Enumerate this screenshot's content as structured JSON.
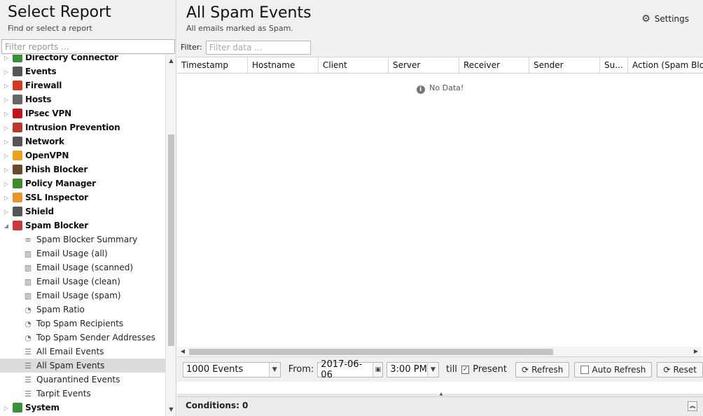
{
  "left": {
    "title": "Select Report",
    "subtitle": "Find or select a report",
    "filter_placeholder": "Filter reports ..."
  },
  "tree": [
    {
      "type": "category",
      "label": "Directory Connector",
      "icon": "directory-connector-icon",
      "color": "#3a8f3a",
      "expanded": false
    },
    {
      "type": "category",
      "label": "Events",
      "icon": "events-icon",
      "color": "#555555",
      "expanded": false
    },
    {
      "type": "category",
      "label": "Firewall",
      "icon": "firewall-icon",
      "color": "#d23a1e",
      "expanded": false
    },
    {
      "type": "category",
      "label": "Hosts",
      "icon": "hosts-icon",
      "color": "#666666",
      "expanded": false
    },
    {
      "type": "category",
      "label": "IPsec VPN",
      "icon": "ipsec-lock-icon",
      "color": "#c0141e",
      "expanded": false
    },
    {
      "type": "category",
      "label": "Intrusion Prevention",
      "icon": "intrusion-prevention-icon",
      "color": "#b83a2a",
      "expanded": false
    },
    {
      "type": "category",
      "label": "Network",
      "icon": "network-icon",
      "color": "#555555",
      "expanded": false
    },
    {
      "type": "category",
      "label": "OpenVPN",
      "icon": "openvpn-icon",
      "color": "#e8a21e",
      "expanded": false
    },
    {
      "type": "category",
      "label": "Phish Blocker",
      "icon": "phish-blocker-icon",
      "color": "#6a4a2a",
      "expanded": false
    },
    {
      "type": "category",
      "label": "Policy Manager",
      "icon": "policy-manager-icon",
      "color": "#3c8a2a",
      "expanded": false
    },
    {
      "type": "category",
      "label": "SSL Inspector",
      "icon": "ssl-inspector-icon",
      "color": "#e8942a",
      "expanded": false
    },
    {
      "type": "category",
      "label": "Shield",
      "icon": "shield-icon",
      "color": "#555555",
      "expanded": false
    },
    {
      "type": "category",
      "label": "Spam Blocker",
      "icon": "spam-blocker-icon",
      "color": "#c83a3a",
      "expanded": true
    },
    {
      "type": "leaf",
      "label": "Spam Blocker Summary",
      "icon": "text-lines-icon",
      "glyph": "≡"
    },
    {
      "type": "leaf",
      "label": "Email Usage (all)",
      "icon": "bar-chart-icon",
      "glyph": "📊"
    },
    {
      "type": "leaf",
      "label": "Email Usage (scanned)",
      "icon": "bar-chart-icon",
      "glyph": "📊"
    },
    {
      "type": "leaf",
      "label": "Email Usage (clean)",
      "icon": "bar-chart-icon",
      "glyph": "📊"
    },
    {
      "type": "leaf",
      "label": "Email Usage (spam)",
      "icon": "bar-chart-icon",
      "glyph": "📊"
    },
    {
      "type": "leaf",
      "label": "Spam Ratio",
      "icon": "pie-chart-icon",
      "glyph": "◔"
    },
    {
      "type": "leaf",
      "label": "Top Spam Recipients",
      "icon": "pie-chart-icon",
      "glyph": "◔"
    },
    {
      "type": "leaf",
      "label": "Top Spam Sender Addresses",
      "icon": "pie-chart-icon",
      "glyph": "◔"
    },
    {
      "type": "leaf",
      "label": "All Email Events",
      "icon": "list-icon",
      "glyph": "☰"
    },
    {
      "type": "leaf",
      "label": "All Spam Events",
      "icon": "list-icon",
      "glyph": "☰",
      "selected": true
    },
    {
      "type": "leaf",
      "label": "Quarantined Events",
      "icon": "list-icon",
      "glyph": "☰"
    },
    {
      "type": "leaf",
      "label": "Tarpit Events",
      "icon": "list-icon",
      "glyph": "☰"
    },
    {
      "type": "category",
      "label": "System",
      "icon": "system-icon",
      "color": "#3a8f3a",
      "expanded": false
    }
  ],
  "main": {
    "title": "All Spam Events",
    "subtitle": "All emails marked as Spam.",
    "settings_label": "Settings",
    "filter_label": "Filter:",
    "filter_placeholder": "Filter data ...",
    "columns": [
      {
        "label": "Timestamp"
      },
      {
        "label": "Hostname"
      },
      {
        "label": "Client"
      },
      {
        "label": "Server"
      },
      {
        "label": "Receiver"
      },
      {
        "label": "Sender"
      },
      {
        "label": "Su..."
      },
      {
        "label": "Action (Spam Blo..."
      }
    ],
    "no_data": "No Data!"
  },
  "toolbar": {
    "events_limit": "1000 Events",
    "from_label": "From:",
    "from_date": "2017-06-06",
    "from_time": "3:00 PM",
    "till_label": "till",
    "present_label": "Present",
    "present_checked": true,
    "refresh_label": "Refresh",
    "auto_refresh_label": "Auto Refresh",
    "reset_label": "Reset"
  },
  "conditions": {
    "label": "Conditions: 0"
  }
}
